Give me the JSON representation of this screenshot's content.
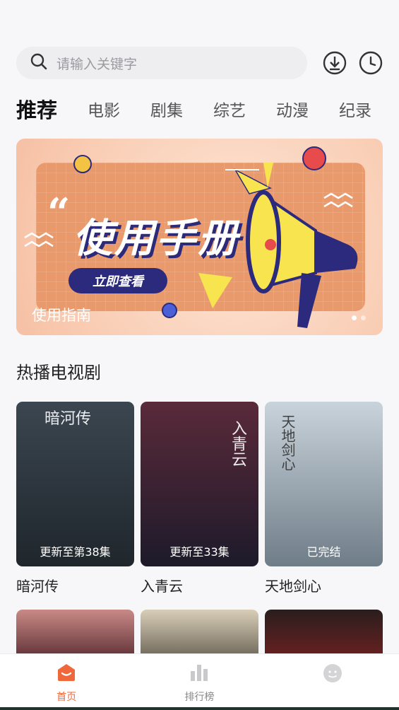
{
  "search": {
    "placeholder": "请输入关键字"
  },
  "header_icons": [
    "download-icon",
    "history-clock-icon"
  ],
  "tabs": [
    {
      "label": "推荐",
      "active": true
    },
    {
      "label": "电影"
    },
    {
      "label": "剧集"
    },
    {
      "label": "综艺"
    },
    {
      "label": "动漫"
    },
    {
      "label": "纪录"
    }
  ],
  "banner": {
    "quote_mark": "“",
    "title": "使用手册",
    "button_label": "立即查看",
    "caption": "使用指南",
    "page_count": 2,
    "active_page": 1
  },
  "section": {
    "title": "热播电视剧"
  },
  "dramas": [
    {
      "title": "暗河传",
      "status": "更新至第38集",
      "poster_text": "暗河传",
      "colors": [
        "#3b4650",
        "#1f262c"
      ]
    },
    {
      "title": "入青云",
      "status": "更新至33集",
      "poster_text": "入青云",
      "colors": [
        "#5a2a3a",
        "#1d1a2a"
      ]
    },
    {
      "title": "天地剑心",
      "status": "已完结",
      "poster_text": "天地剑心",
      "colors": [
        "#c9d3db",
        "#6f7d88"
      ]
    }
  ],
  "row2_colors": [
    [
      "#c98a86",
      "#5e2f35"
    ],
    [
      "#d9cfb8",
      "#6b6356"
    ],
    [
      "#2a1e1e",
      "#6b2020"
    ]
  ],
  "nav": [
    {
      "label": "首页",
      "icon": "home-icon",
      "active": true
    },
    {
      "label": "排行榜",
      "icon": "ranking-chart-icon"
    },
    {
      "label": "",
      "icon": "profile-face-icon"
    }
  ],
  "colors": {
    "accent": "#f0673b",
    "banner_dark": "#2b2a7d"
  }
}
